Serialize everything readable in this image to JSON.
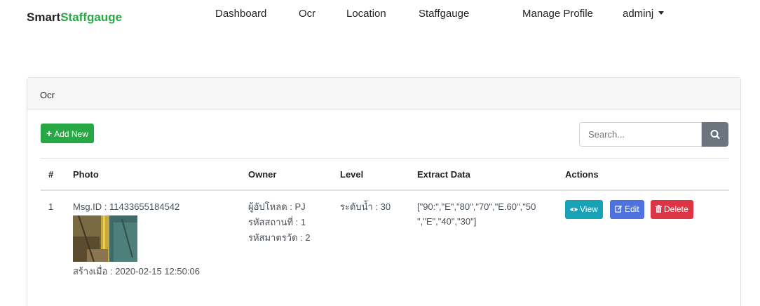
{
  "brand": {
    "part1": "Smart",
    "part2": "Staffgauge"
  },
  "nav": {
    "items": [
      "Dashboard",
      "Ocr",
      "Location",
      "Staffgauge",
      "Manage Profile"
    ],
    "user": "adminj"
  },
  "card": {
    "header": "Ocr",
    "add_button": "Add New",
    "search_placeholder": "Search..."
  },
  "table": {
    "headers": [
      "#",
      "Photo",
      "Owner",
      "Level",
      "Extract Data",
      "Actions"
    ],
    "rows": [
      {
        "index": "1",
        "msg_id": "Msg.ID : 11433655184542",
        "created": "สร้างเมื่อ : 2020-02-15 12:50:06",
        "uploader": "ผู้อัปโหลด : PJ",
        "station": "รหัสสถานที่ : 1",
        "gauge": "รหัสมาตรวัด : 2",
        "level": "ระดับน้ำ : 30",
        "extract_line1": "[\"90:\",\"E\",\"80\",\"70\",\"E.60\",\"50",
        "extract_line2": "\",\"E\",\"40\",\"30\"]"
      }
    ],
    "actions": {
      "view": "View",
      "edit": "Edit",
      "delete": "Delete"
    }
  },
  "colors": {
    "brand_green": "#28a745",
    "view": "#17a2b8",
    "edit": "#4e73df",
    "delete": "#dc3545",
    "search_button": "#6c757d"
  }
}
